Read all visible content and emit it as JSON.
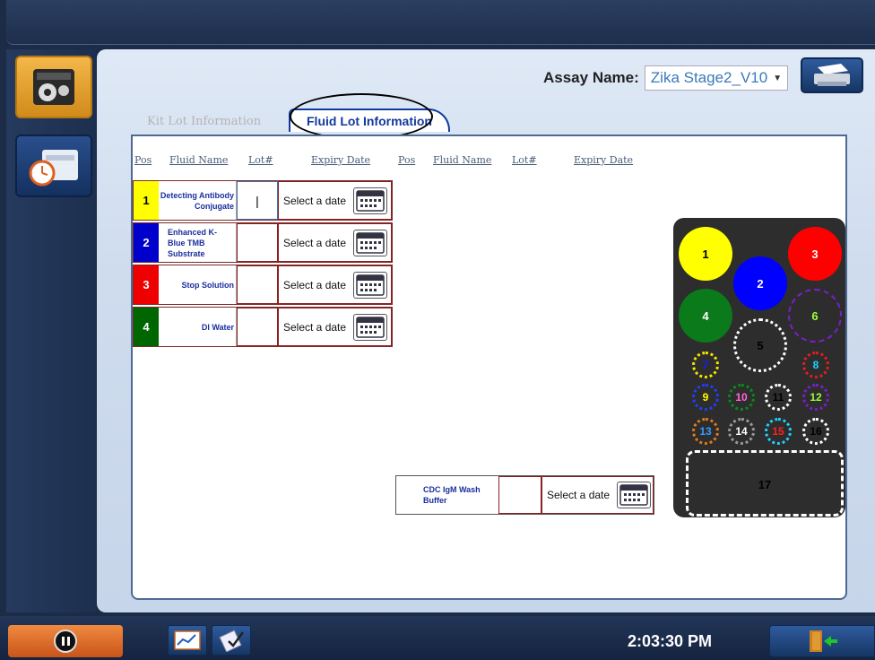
{
  "header": {
    "assay_label": "Assay Name:",
    "assay_value": "Zika Stage2_V10",
    "assay_icon": "chevron-down-icon",
    "print_icon": "printer-icon"
  },
  "sidebar": {
    "items": [
      {
        "icon": "instrument-settings-icon",
        "active": true
      },
      {
        "icon": "maintenance-clock-icon",
        "active": false
      }
    ]
  },
  "tabs": [
    {
      "label": "Kit Lot Information",
      "active": false
    },
    {
      "label": "Fluid Lot Information",
      "active": true
    }
  ],
  "table": {
    "headers": [
      "Pos",
      "Fluid Name",
      "Lot#",
      "Expiry Date",
      "Pos",
      "Fluid Name",
      "Lot#",
      "Expiry Date"
    ],
    "rows": [
      {
        "pos": "1",
        "name": "Detecting Antibody Conjugate",
        "lot": "|",
        "date_placeholder": "Select a date",
        "color": "#ffff00"
      },
      {
        "pos": "2",
        "name": "Enhanced K-Blue TMB Substrate",
        "lot": "",
        "date_placeholder": "Select a date",
        "color": "#0000cc"
      },
      {
        "pos": "3",
        "name": "Stop Solution",
        "lot": "",
        "date_placeholder": "Select a date",
        "color": "#ee0000"
      },
      {
        "pos": "4",
        "name": "DI Water",
        "lot": "",
        "date_placeholder": "Select a date",
        "color": "#006600"
      }
    ],
    "wash_row": {
      "name": "CDC IgM Wash Buffer",
      "lot": "",
      "date_placeholder": "Select a date"
    }
  },
  "tray": {
    "positions": [
      "1",
      "2",
      "3",
      "4",
      "5",
      "6",
      "7",
      "8",
      "9",
      "10",
      "11",
      "12",
      "13",
      "14",
      "15",
      "16",
      "17"
    ]
  },
  "footer": {
    "clock": "2:03:30 PM",
    "pause_icon": "pause-icon",
    "exit_icon": "exit-door-icon"
  }
}
